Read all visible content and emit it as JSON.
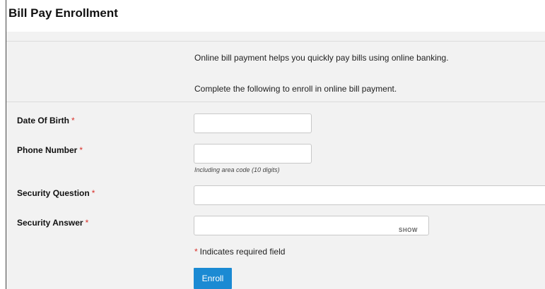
{
  "page": {
    "title": "Bill Pay Enrollment"
  },
  "intro": {
    "line1": "Online bill payment helps you quickly pay bills using online banking.",
    "line2": "Complete the following to enroll in online bill payment."
  },
  "form": {
    "required_marker": "*",
    "dob": {
      "label": "Date Of Birth",
      "value": ""
    },
    "phone": {
      "label": "Phone Number",
      "value": "",
      "hint": "Including area code (10 digits)"
    },
    "security_question": {
      "label": "Security Question",
      "value": ""
    },
    "security_answer": {
      "label": "Security Answer",
      "value": "",
      "show_label": "SHOW"
    },
    "required_note_text": "Indicates required field",
    "enroll_label": "Enroll"
  },
  "colors": {
    "accent": "#1b8ad3",
    "required": "#d9302a",
    "panel_bg": "#f2f2f2"
  }
}
